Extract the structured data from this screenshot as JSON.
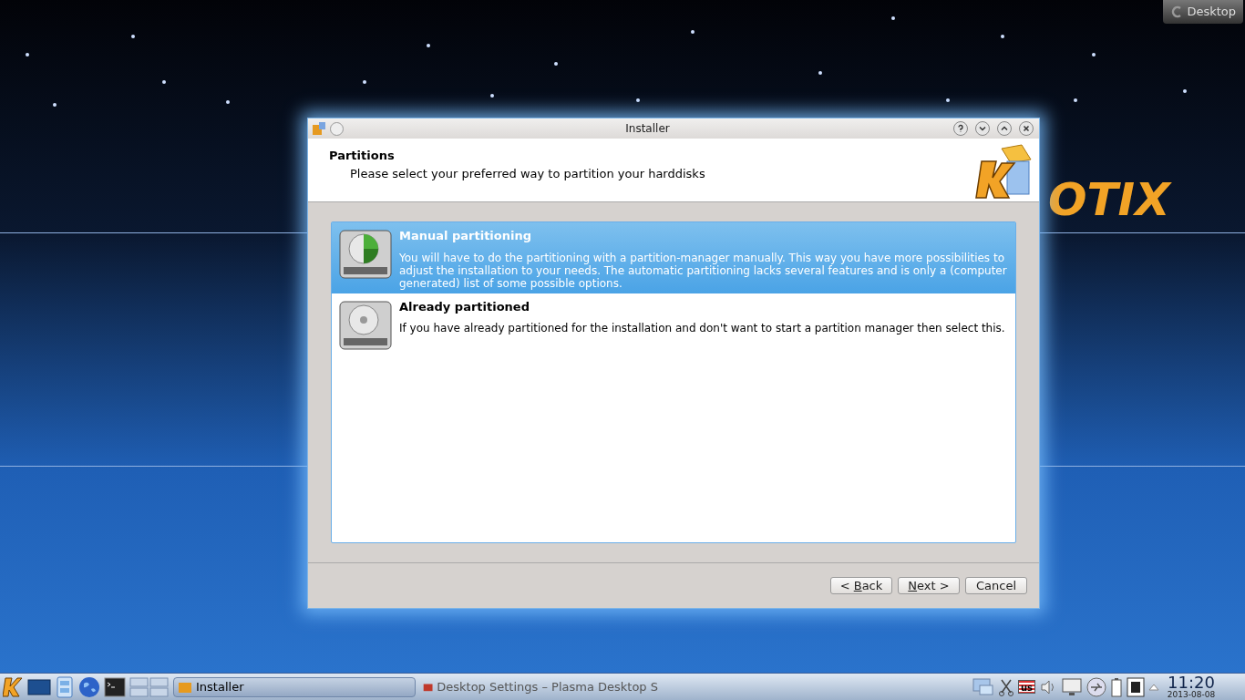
{
  "desktop": {
    "logo_text": "OTIX",
    "desktop_button": "Desktop"
  },
  "window": {
    "title": "Installer",
    "header": {
      "title": "Partitions",
      "subtitle": "Please select your preferred way to partition your harddisks"
    },
    "options": [
      {
        "title": "Manual partitioning",
        "description": "You will have to do the partitioning with a partition-manager manually. This way you have more possibilities to adjust the installation to your needs. The automatic partitioning lacks several features and is only a (computer generated) list of some possible options.",
        "selected": true,
        "kind": "manual"
      },
      {
        "title": "Already partitioned",
        "description": "If you have already partitioned for the installation and don't want to start a partition manager then select this.",
        "selected": false,
        "kind": "plain"
      }
    ],
    "buttons": [
      {
        "before": "< ",
        "key": "B",
        "after": "ack"
      },
      {
        "key": "N",
        "after": "ext >"
      },
      {
        "before": "Cancel"
      }
    ]
  },
  "taskbar": {
    "tasks": [
      {
        "label": "Installer",
        "selected": true
      },
      {
        "label": "Desktop Settings – Plasma Desktop S",
        "selected": false
      }
    ],
    "keyboard_layout": "us",
    "clock": {
      "time": "11:20",
      "date": "2013-08-08"
    }
  }
}
